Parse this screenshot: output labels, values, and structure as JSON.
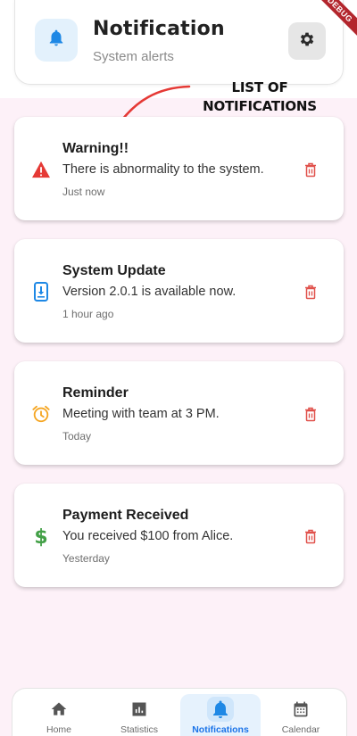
{
  "header": {
    "title": "Notification",
    "subtitle": "System alerts",
    "icon": "bell-icon",
    "settings_icon": "gear-icon",
    "debug_banner": "DEBUG"
  },
  "annotation": {
    "line1": "LIST OF",
    "line2": "NOTIFICATIONS"
  },
  "notifications": [
    {
      "title": "Warning!!",
      "message": "There is abnormality to the system.",
      "time": "Just now",
      "icon": "warning-icon",
      "icon_color": "#e53935"
    },
    {
      "title": "System Update",
      "message": "Version 2.0.1 is available now.",
      "time": "1 hour ago",
      "icon": "phone-download-icon",
      "icon_color": "#1e88e5"
    },
    {
      "title": "Reminder",
      "message": "Meeting with team at 3 PM.",
      "time": "Today",
      "icon": "alarm-clock-icon",
      "icon_color": "#f5a623"
    },
    {
      "title": "Payment Received",
      "message": "You received $100 from Alice.",
      "time": "Yesterday",
      "icon": "dollar-icon",
      "icon_color": "#43a047"
    }
  ],
  "delete_icon_color": "#e0504a",
  "nav": {
    "items": [
      {
        "label": "Home",
        "icon": "home-icon"
      },
      {
        "label": "Statistics",
        "icon": "bar-chart-icon"
      },
      {
        "label": "Notifications",
        "icon": "bell-icon",
        "active": true
      },
      {
        "label": "Calendar",
        "icon": "calendar-icon"
      }
    ],
    "active_color": "#1a73e8",
    "inactive_color": "#555555"
  }
}
